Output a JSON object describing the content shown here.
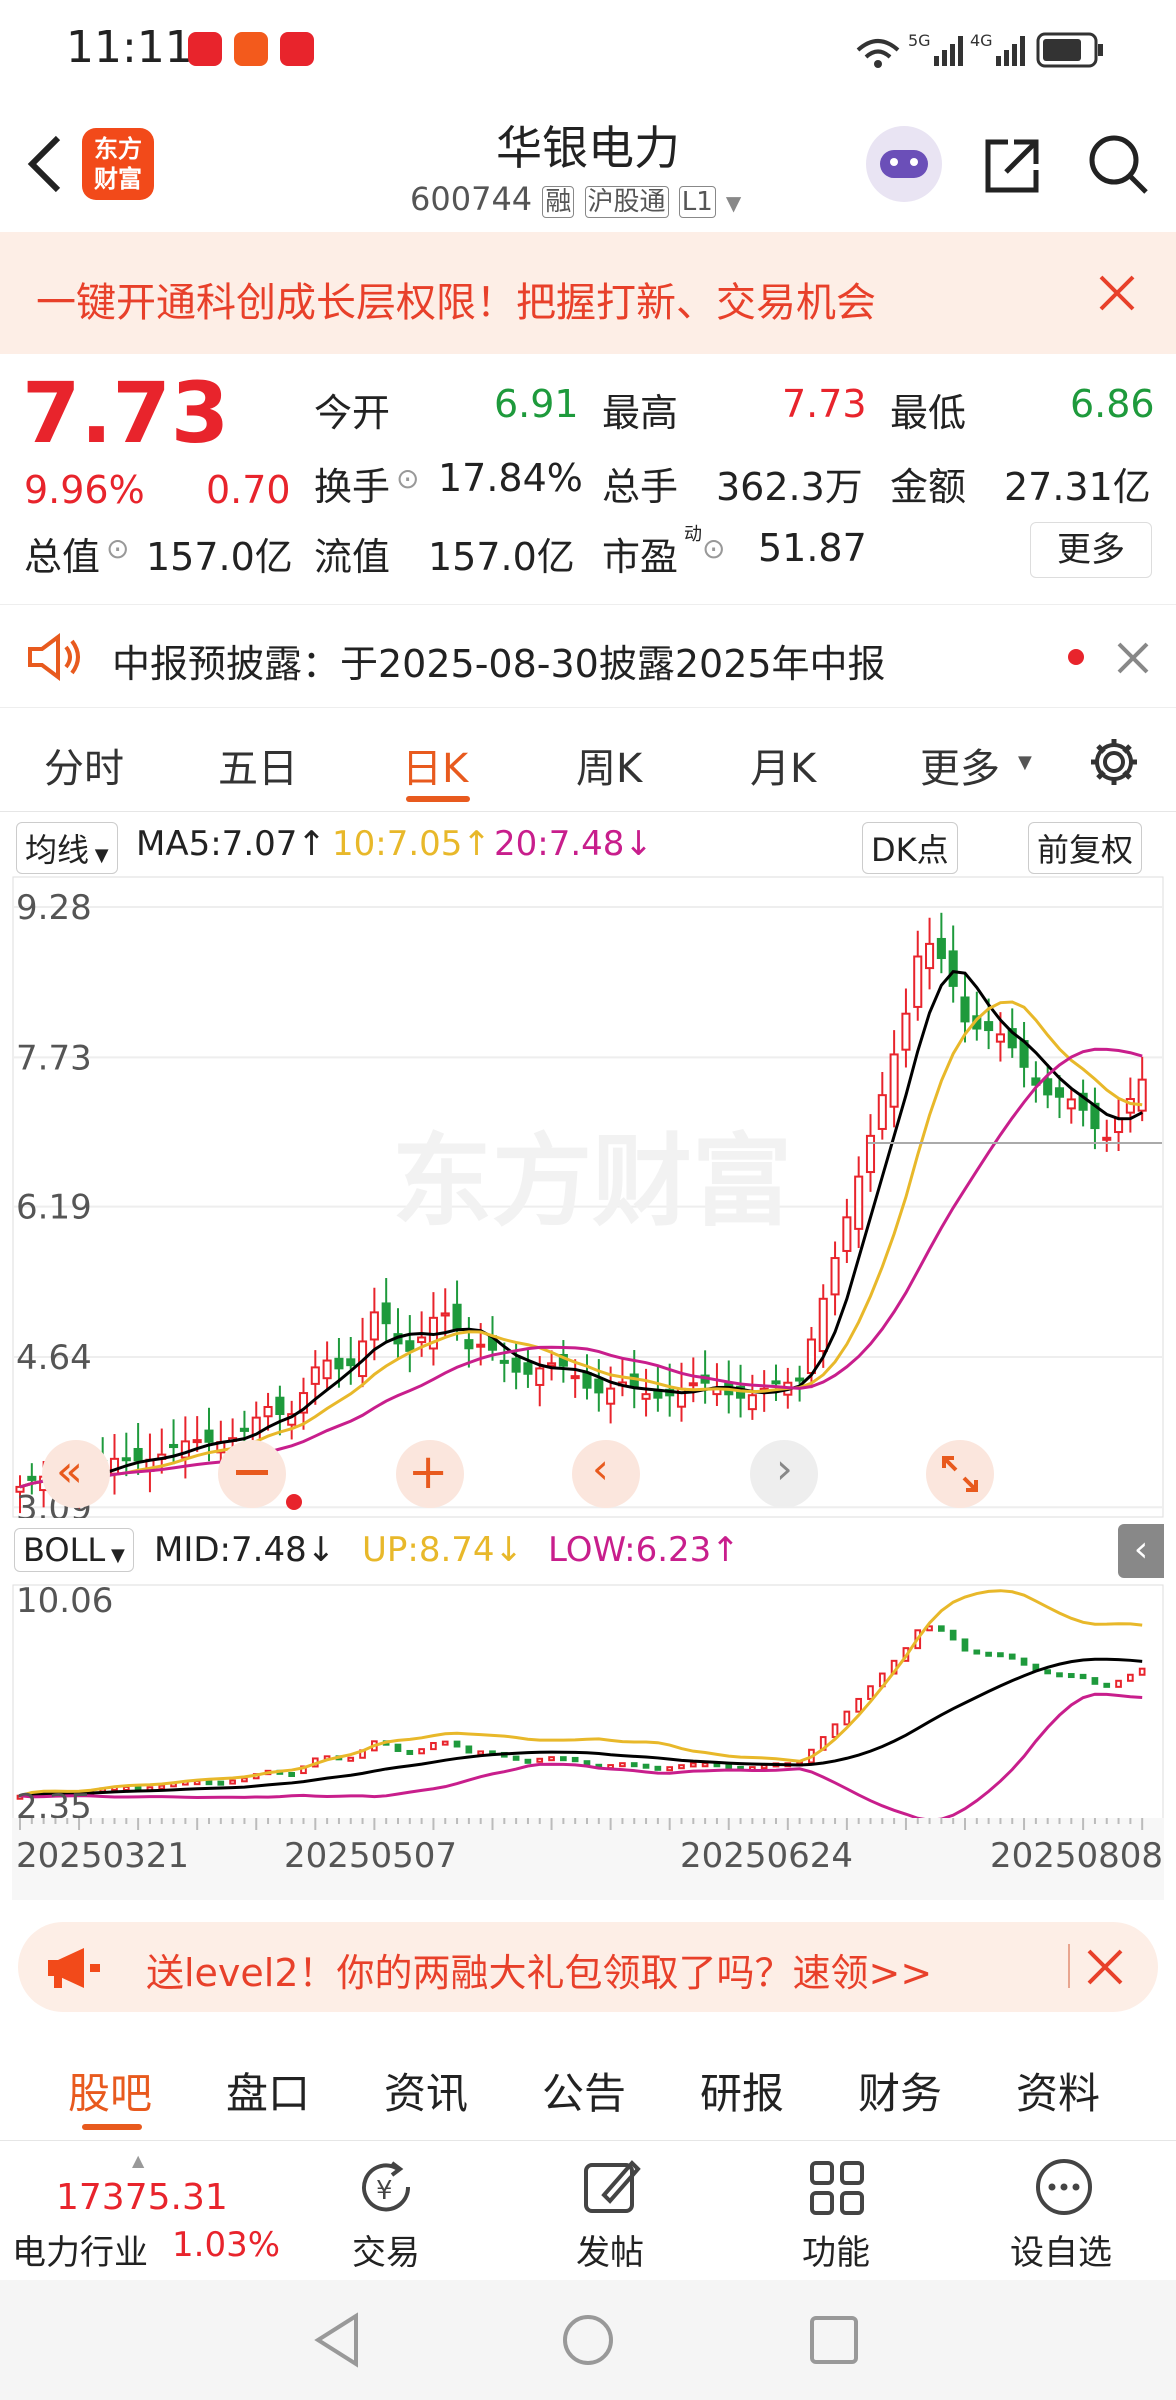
{
  "status": {
    "time": "11:11",
    "network": "5G 4G"
  },
  "header": {
    "title": "华银电力",
    "code": "600744",
    "tags": [
      "融",
      "沪股通",
      "L1"
    ]
  },
  "banner": {
    "text": "一键开通科创成长层权限！把握打新、交易机会"
  },
  "quote": {
    "price": "7.73",
    "pct": "9.96%",
    "change": "0.70",
    "open_label": "今开",
    "open": "6.91",
    "high_label": "最高",
    "high": "7.73",
    "low_label": "最低",
    "low": "6.86",
    "turnover_label": "换手",
    "turnover": "17.84%",
    "volume_label": "总手",
    "volume": "362.3万",
    "amount_label": "金额",
    "amount": "27.31亿",
    "mcap_label": "总值",
    "mcap": "157.0亿",
    "float_label": "流值",
    "float": "157.0亿",
    "pe_label": "市盈",
    "pe_sup": "动",
    "pe": "51.87",
    "more": "更多"
  },
  "notice": {
    "text": "中报预披露：于2025-08-30披露2025年中报"
  },
  "tabs": [
    "分时",
    "五日",
    "日K",
    "周K",
    "月K",
    "更多"
  ],
  "active_tab": 2,
  "ma": {
    "selector": "均线",
    "ma5": "MA5:7.07",
    "ma10": "10:7.05",
    "ma20": "20:7.48",
    "dk": "DK点",
    "adjust": "前复权"
  },
  "kchart": {
    "y_labels": [
      "9.28",
      "7.73",
      "6.19",
      "4.64",
      "3.09"
    ],
    "watermark": "东方财富"
  },
  "boll": {
    "selector": "BOLL",
    "mid": "MID:7.48",
    "up": "UP:8.74",
    "low": "LOW:6.23",
    "y_top": "10.06",
    "y_bottom": "2.35"
  },
  "x_dates": [
    "20250321",
    "20250507",
    "20250624",
    "20250808"
  ],
  "promo": {
    "text": "送level2！你的两融大礼包领取了吗？速领>>"
  },
  "bottom_tabs": [
    "股吧",
    "盘口",
    "资讯",
    "公告",
    "研报",
    "财务",
    "资料"
  ],
  "dock": {
    "index_value": "17375.31",
    "industry": "电力行业",
    "industry_pct": "1.03%",
    "items": [
      "交易",
      "发帖",
      "功能",
      "设自选"
    ]
  },
  "colors": {
    "up": "#e8242c",
    "down": "#1e9a3c",
    "accent": "#e85a1e",
    "ma5": "#000000",
    "ma10": "#e8b82a",
    "ma20": "#c81e8c"
  }
}
